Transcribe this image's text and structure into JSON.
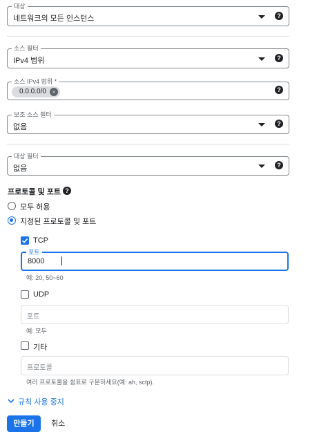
{
  "target": {
    "legend": "대상",
    "value": "네트워크의 모든 인스턴스"
  },
  "source_filter": {
    "legend": "소스 필터",
    "value": "IPv4 범위"
  },
  "source_ipv4_ranges": {
    "legend": "소스 IPv4 범위 *",
    "chip": "0.0.0.0/0"
  },
  "secondary_source_filter": {
    "legend": "보조 소스 필터",
    "value": "없음"
  },
  "destination_filter": {
    "legend": "대상 필터",
    "value": "없음"
  },
  "protocols": {
    "title": "프로토콜 및 포트",
    "allow_all": "모두 허용",
    "specified": "지정된 프로토콜 및 포트",
    "tcp": {
      "label": "TCP",
      "legend": "포트",
      "value": "8000",
      "hint": "예: 20, 50~60"
    },
    "udp": {
      "label": "UDP",
      "placeholder": "포트",
      "hint": "예: 모두"
    },
    "other": {
      "label": "기타",
      "placeholder": "프로토콜",
      "hint": "여러 프로토콜을 쉼표로 구분하세요(예: ah, sctp)."
    }
  },
  "disable_rule": "규칙 사용 중지",
  "buttons": {
    "create": "만들기",
    "cancel": "취소"
  }
}
